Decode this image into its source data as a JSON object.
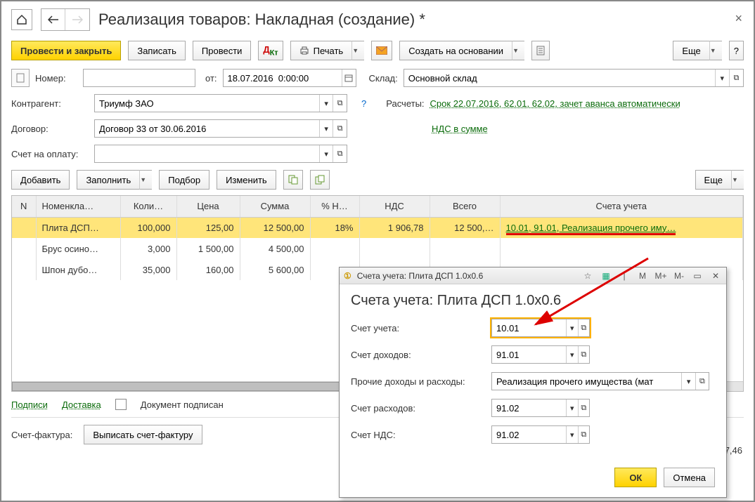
{
  "title": "Реализация товаров: Накладная (создание) *",
  "toolbar": {
    "post_close": "Провести и закрыть",
    "save": "Записать",
    "post": "Провести",
    "print": "Печать",
    "create_based": "Создать на основании",
    "more": "Еще"
  },
  "form": {
    "number_label": "Номер:",
    "number_value": "",
    "date_label": "от:",
    "date_value": "18.07.2016  0:00:00",
    "warehouse_label": "Склад:",
    "warehouse_value": "Основной склад",
    "counterparty_label": "Контрагент:",
    "counterparty_value": "Триумф ЗАО",
    "calc_label": "Расчеты:",
    "calc_link": "Срок 22.07.2016, 62.01, 62.02, зачет аванса автоматически",
    "contract_label": "Договор:",
    "contract_value": "Договор 33 от 30.06.2016",
    "vat_link": "НДС в сумме",
    "pay_account_label": "Счет на оплату:",
    "pay_account_value": ""
  },
  "grid_toolbar": {
    "add": "Добавить",
    "fill": "Заполнить",
    "pick": "Подбор",
    "edit": "Изменить",
    "more": "Еще"
  },
  "columns": [
    "N",
    "Номенкла…",
    "Коли…",
    "Цена",
    "Сумма",
    "% Н…",
    "НДС",
    "Всего",
    "Счета учета"
  ],
  "rows": [
    {
      "n": "",
      "name": "Плита ДСП…",
      "qty": "100,000",
      "price": "125,00",
      "sum": "12 500,00",
      "vatp": "18%",
      "vat": "1 906,78",
      "total": "12 500,…",
      "accounts": "10.01, 91.01, Реализация прочего иму…",
      "selected": true
    },
    {
      "n": "",
      "name": "Брус осино…",
      "qty": "3,000",
      "price": "1 500,00",
      "sum": "4 500,00",
      "vatp": "",
      "vat": "",
      "total": "",
      "accounts": ""
    },
    {
      "n": "",
      "name": "Шпон дубо…",
      "qty": "35,000",
      "price": "160,00",
      "sum": "5 600,00",
      "vatp": "",
      "vat": "",
      "total": "",
      "accounts": ""
    }
  ],
  "footer": {
    "signatures": "Подписи",
    "delivery": "Доставка",
    "doc_signed": "Документ подписан",
    "sf_label": "Счет-фактура:",
    "sf_button": "Выписать счет-фактуру",
    "grand_total_fragment": "7,46"
  },
  "popup": {
    "win_title": "Счета учета: Плита ДСП 1.0x0.6",
    "nav": {
      "m": "M",
      "mplus": "M+",
      "mminus": "M-"
    },
    "title": "Счета учета: Плита ДСП 1.0x0.6",
    "fields": {
      "account_label": "Счет учета:",
      "account_value": "10.01",
      "income_label": "Счет доходов:",
      "income_value": "91.01",
      "other_label": "Прочие доходы и расходы:",
      "other_value": "Реализация прочего имущества (мат",
      "expense_label": "Счет расходов:",
      "expense_value": "91.02",
      "vat_label": "Счет НДС:",
      "vat_value": "91.02"
    },
    "ok": "ОК",
    "cancel": "Отмена"
  }
}
